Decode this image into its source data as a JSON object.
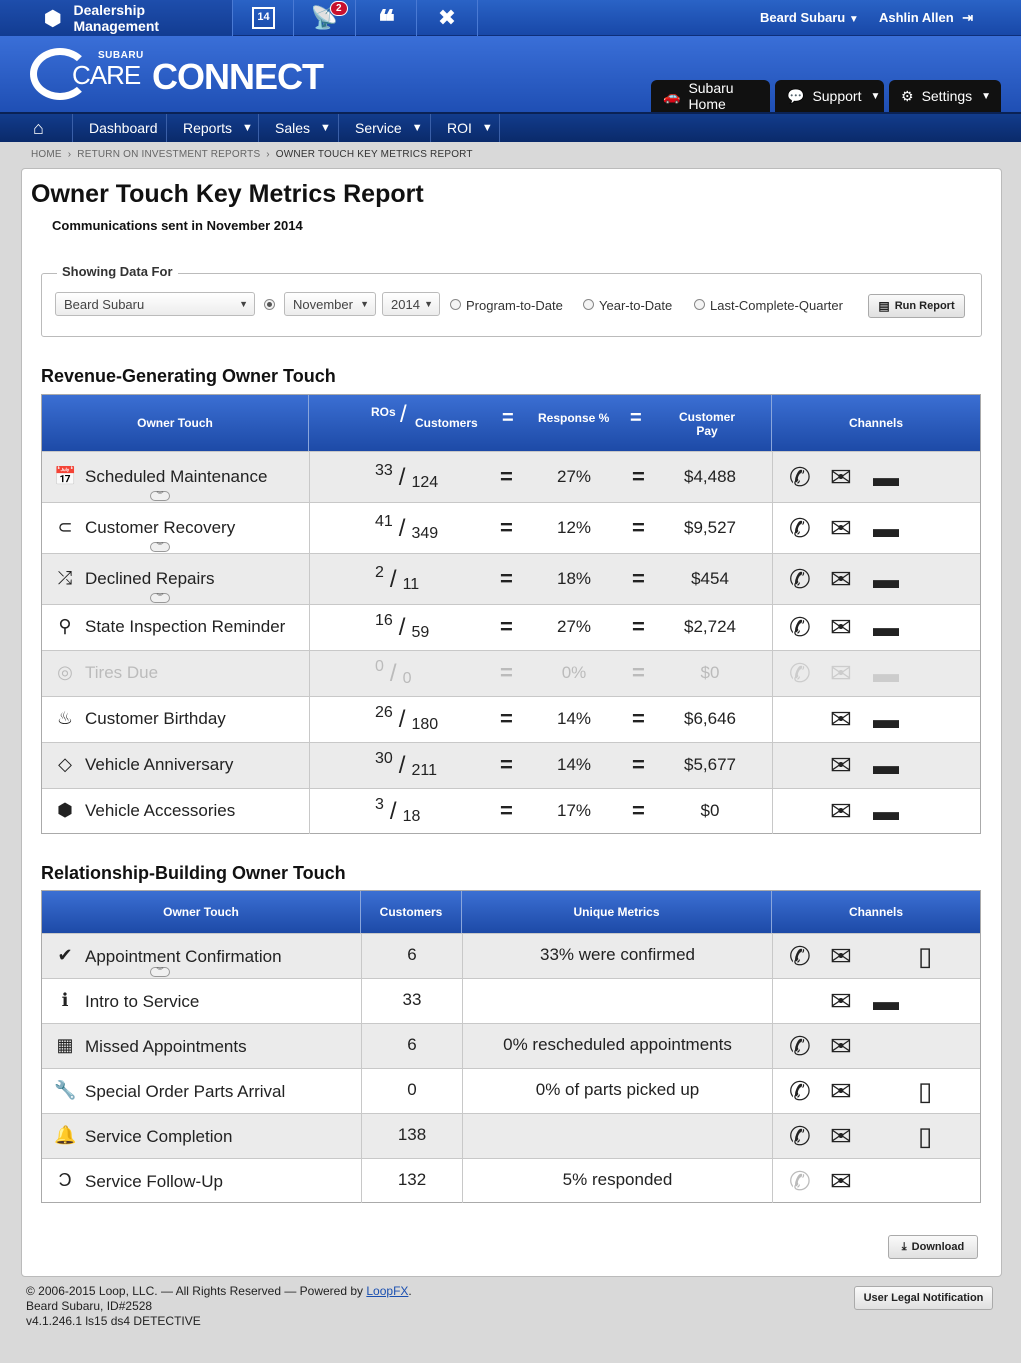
{
  "topbar": {
    "app_name": "Dealership Management",
    "notifications_count": "2",
    "dealer": "Beard Subaru",
    "user": "Ashlin Allen"
  },
  "header": {
    "logo_sub": "SUBARU",
    "logo_care": "CARE",
    "logo_connect": "CONNECT",
    "buttons": [
      {
        "label": "Subaru Home"
      },
      {
        "label": "Support"
      },
      {
        "label": "Settings"
      }
    ]
  },
  "nav": {
    "items": [
      {
        "label": "Dashboard"
      },
      {
        "label": "Reports"
      },
      {
        "label": "Sales"
      },
      {
        "label": "Service"
      },
      {
        "label": "ROI"
      }
    ]
  },
  "breadcrumb": {
    "home": "HOME",
    "roi": "RETURN ON INVESTMENT REPORTS",
    "current": "OWNER TOUCH KEY METRICS REPORT"
  },
  "page": {
    "title": "Owner Touch Key Metrics Report",
    "subtitle": "Communications sent in November 2014"
  },
  "filters": {
    "legend": "Showing Data For",
    "dealer": "Beard Subaru",
    "month": "November",
    "year": "2014",
    "options": [
      "Program-to-Date",
      "Year-to-Date",
      "Last-Complete-Quarter"
    ],
    "run_label": "Run Report"
  },
  "revenue": {
    "title": "Revenue-Generating Owner Touch",
    "headers": {
      "owner_touch": "Owner Touch",
      "ros": "ROs",
      "customers": "Customers",
      "response": "Response %",
      "pay": "Customer Pay",
      "channels": "Channels"
    },
    "rows": [
      {
        "name": "Scheduled Maintenance",
        "icon": "calendar-icon",
        "ros": "33",
        "customers": "124",
        "response": "27%",
        "pay": "$4,488"
      },
      {
        "name": "Customer Recovery",
        "icon": "magnet-icon",
        "ros": "41",
        "customers": "349",
        "response": "12%",
        "pay": "$9,527"
      },
      {
        "name": "Declined Repairs",
        "icon": "shuffle-icon",
        "ros": "2",
        "customers": "11",
        "response": "18%",
        "pay": "$454"
      },
      {
        "name": "State Inspection Reminder",
        "icon": "inspection-icon",
        "ros": "16",
        "customers": "59",
        "response": "27%",
        "pay": "$2,724"
      },
      {
        "name": "Tires Due",
        "icon": "tire-icon",
        "ros": "0",
        "customers": "0",
        "response": "0%",
        "pay": "$0"
      },
      {
        "name": "Customer Birthday",
        "icon": "cake-icon",
        "ros": "26",
        "customers": "180",
        "response": "14%",
        "pay": "$6,646"
      },
      {
        "name": "Vehicle Anniversary",
        "icon": "diamond-icon",
        "ros": "30",
        "customers": "211",
        "response": "14%",
        "pay": "$5,677"
      },
      {
        "name": "Vehicle Accessories",
        "icon": "box-icon",
        "ros": "3",
        "customers": "18",
        "response": "17%",
        "pay": "$0"
      }
    ]
  },
  "relationship": {
    "title": "Relationship-Building Owner Touch",
    "headers": {
      "owner_touch": "Owner Touch",
      "customers": "Customers",
      "metrics": "Unique Metrics",
      "channels": "Channels"
    },
    "rows": [
      {
        "name": "Appointment Confirmation",
        "icon": "checkmark-icon",
        "customers": "6",
        "metric": "33% were confirmed"
      },
      {
        "name": "Intro to Service",
        "icon": "info-icon",
        "customers": "33",
        "metric": ""
      },
      {
        "name": "Missed Appointments",
        "icon": "calendar-missed-icon",
        "customers": "6",
        "metric": "0% rescheduled appointments"
      },
      {
        "name": "Special Order Parts Arrival",
        "icon": "wrench-icon",
        "customers": "0",
        "metric": "0% of parts picked up"
      },
      {
        "name": "Service Completion",
        "icon": "bell-icon",
        "customers": "138",
        "metric": ""
      },
      {
        "name": "Service Follow-Up",
        "icon": "follow-up-icon",
        "customers": "132",
        "metric": "5% responded"
      }
    ]
  },
  "download_label": "Download",
  "footer": {
    "copyright": "© 2006-2015 Loop, LLC. — All Rights Reserved — Powered by",
    "link": "LoopFX",
    "period": ".",
    "dealer_id": "Beard Subaru, ID#2528",
    "version": "v4.1.246.1 ls15 ds4 DETECTIVE",
    "legal": "User Legal Notification"
  }
}
